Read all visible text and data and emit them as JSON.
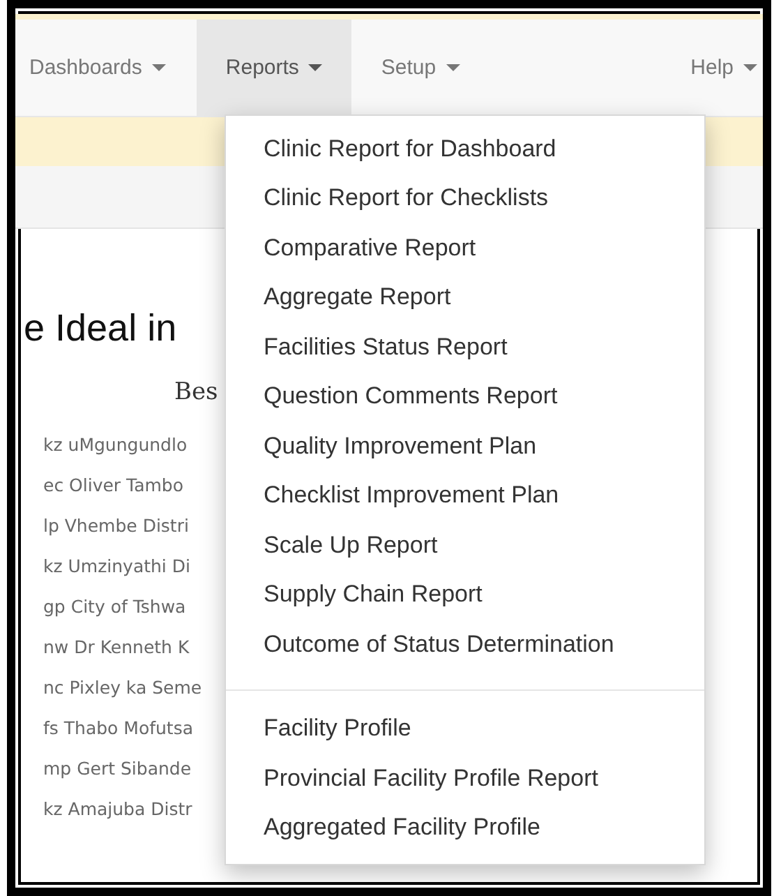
{
  "navbar": {
    "items": [
      {
        "label": "Dashboards",
        "selected": false
      },
      {
        "label": "Reports",
        "selected": true
      },
      {
        "label": "Setup",
        "selected": false
      },
      {
        "label": "Help",
        "selected": false
      }
    ]
  },
  "dropdown": {
    "groups": [
      [
        "Clinic Report for Dashboard",
        "Clinic Report for Checklists",
        "Comparative Report",
        "Aggregate Report",
        "Facilities Status Report",
        "Question Comments Report",
        "Quality Improvement Plan",
        "Checklist Improvement Plan",
        "Scale Up Report",
        "Supply Chain Report",
        "Outcome of Status Determination"
      ],
      [
        "Facility Profile",
        "Provincial Facility Profile Report",
        "Aggregated Facility Profile"
      ]
    ]
  },
  "heading": "e Ideal in",
  "subheading": "Bes",
  "districts": [
    "kz uMgungundlo",
    "ec Oliver Tambo",
    "lp Vhembe Distri",
    "kz Umzinyathi Di",
    "gp City of Tshwa",
    "nw Dr Kenneth K",
    "nc Pixley ka Seme",
    "fs Thabo Mofutsa",
    "mp Gert Sibande",
    "kz Amajuba Distr"
  ]
}
